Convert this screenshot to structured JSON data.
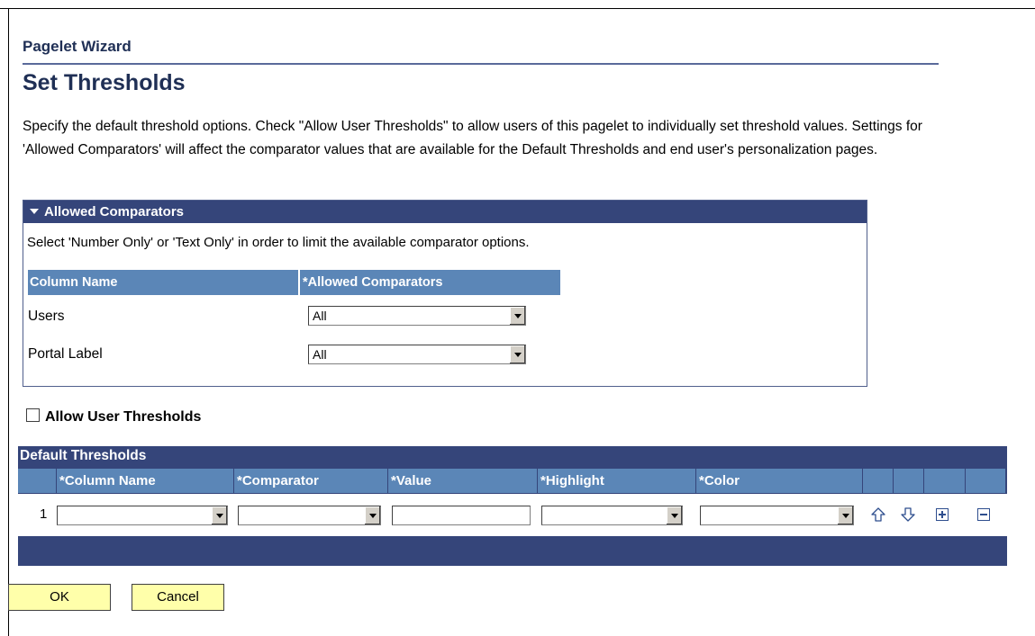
{
  "header": {
    "wizard_title": "Pagelet Wizard",
    "page_title": "Set Thresholds",
    "instructions": "Specify the default threshold options. Check \"Allow User Thresholds\" to allow users of this pagelet to individually set threshold values. Settings for 'Allowed Comparators' will affect the comparator values that are available for the Default Thresholds and end user's personalization pages."
  },
  "allowed_comparators": {
    "title": "Allowed Comparators",
    "note": "Select 'Number Only' or 'Text Only' in order to limit the available comparator options.",
    "columns": [
      "Column Name",
      "*Allowed Comparators"
    ],
    "rows": [
      {
        "column_name": "Users",
        "comparator": "All"
      },
      {
        "column_name": "Portal Label",
        "comparator": "All"
      }
    ]
  },
  "allow_user_thresholds": {
    "label": "Allow User Thresholds",
    "checked": false
  },
  "default_thresholds": {
    "title": "Default Thresholds",
    "columns": [
      "*Column Name",
      "*Comparator",
      "*Value",
      "*Highlight",
      "*Color"
    ],
    "rows": [
      {
        "num": "1",
        "column_name": "",
        "comparator": "",
        "value": "",
        "highlight": "",
        "color": ""
      }
    ],
    "icons": [
      "move-up-icon",
      "move-down-icon",
      "add-row-icon",
      "delete-row-icon"
    ]
  },
  "buttons": {
    "ok": "OK",
    "cancel": "Cancel"
  },
  "colors": {
    "header_dark": "#35457a",
    "header_light": "#5b86b7",
    "button_bg": "#ffffaa",
    "title_text": "#1f2f55"
  }
}
